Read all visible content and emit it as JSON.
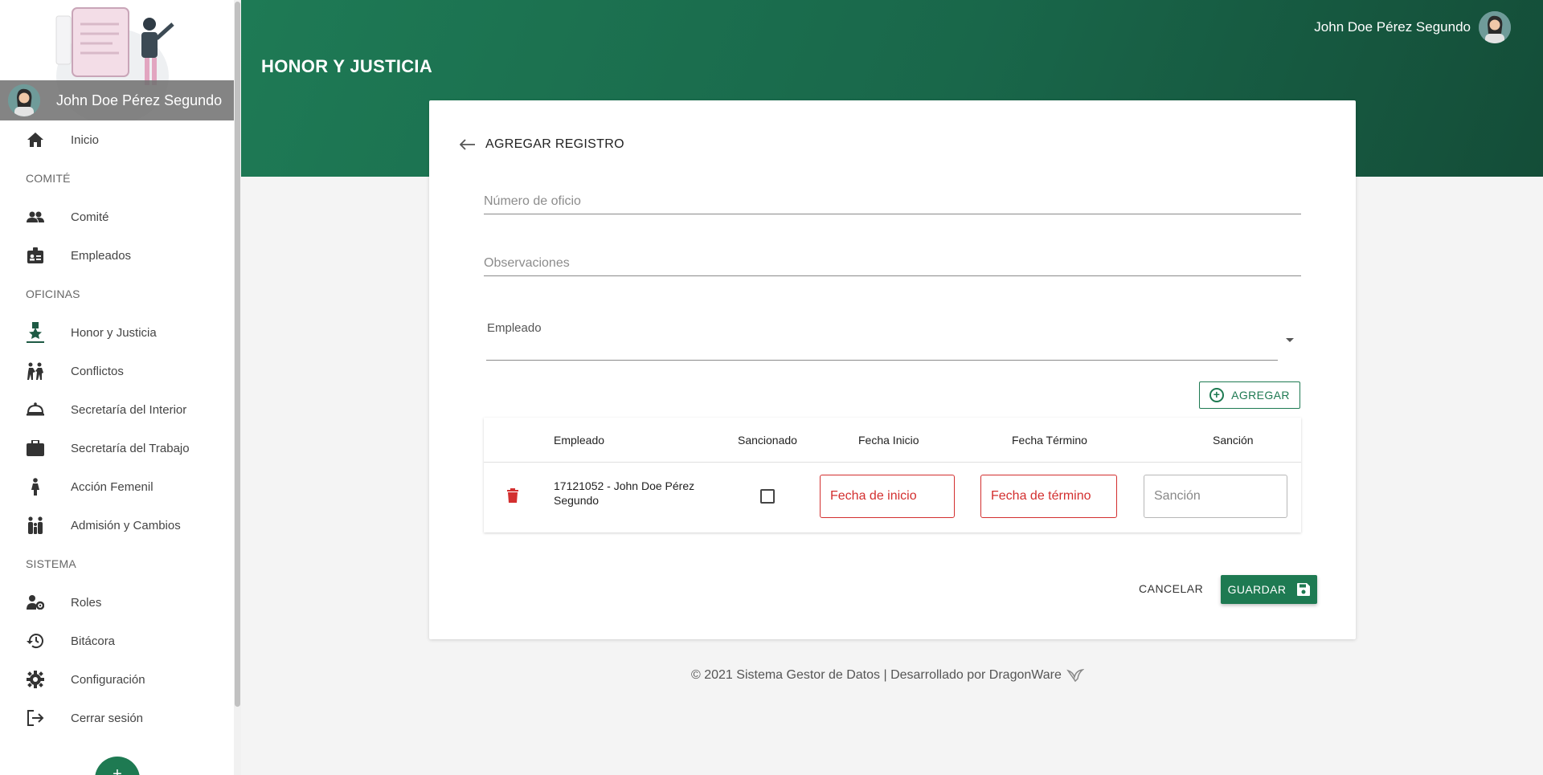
{
  "sidebar": {
    "user_name": "John Doe Pérez Segundo",
    "items": [
      {
        "label": "Inicio",
        "icon": "home-icon"
      },
      {
        "section": "COMITÉ"
      },
      {
        "label": "Comité",
        "icon": "people-icon"
      },
      {
        "label": "Empleados",
        "icon": "badge-icon"
      },
      {
        "section": "OFICINAS"
      },
      {
        "label": "Honor y Justicia",
        "icon": "medal-icon"
      },
      {
        "label": "Conflictos",
        "icon": "conflict-icon"
      },
      {
        "label": "Secretaría del Interior",
        "icon": "service-bell-icon"
      },
      {
        "label": "Secretaría del Trabajo",
        "icon": "briefcase-icon"
      },
      {
        "label": "Acción Femenil",
        "icon": "woman-icon"
      },
      {
        "label": "Admisión y Cambios",
        "icon": "family-icon"
      },
      {
        "section": "SISTEMA"
      },
      {
        "label": "Roles",
        "icon": "user-gear-icon"
      },
      {
        "label": "Bitácora",
        "icon": "history-icon"
      },
      {
        "label": "Configuración",
        "icon": "gear-icon"
      },
      {
        "label": "Cerrar sesión",
        "icon": "logout-icon"
      }
    ]
  },
  "header": {
    "title": "HONOR Y JUSTICIA",
    "user_name": "John Doe Pérez Segundo",
    "color_start": "#1e7a55",
    "color_end": "#144d38"
  },
  "form": {
    "back_label": "AGREGAR REGISTRO",
    "oficio_placeholder": "Número de oficio",
    "observaciones_placeholder": "Observaciones",
    "empleado_label": "Empleado",
    "add_label": "AGREGAR",
    "table": {
      "headers": [
        "Empleado",
        "Sancionado",
        "Fecha Inicio",
        "Fecha Término",
        "Sanción"
      ],
      "rows": [
        {
          "empleado": "17121052 - John Doe Pérez Segundo",
          "sancionado": false,
          "fecha_inicio_placeholder": "Fecha de inicio",
          "fecha_termino_placeholder": "Fecha de término",
          "sancion_placeholder": "Sanción"
        }
      ]
    },
    "cancel_label": "CANCELAR",
    "save_label": "GUARDAR"
  },
  "footer": {
    "text": "© 2021 Sistema Gestor de Datos | Desarrollado por DragonWare"
  },
  "colors": {
    "accent": "#1e7a52",
    "error": "#d32f2f"
  }
}
